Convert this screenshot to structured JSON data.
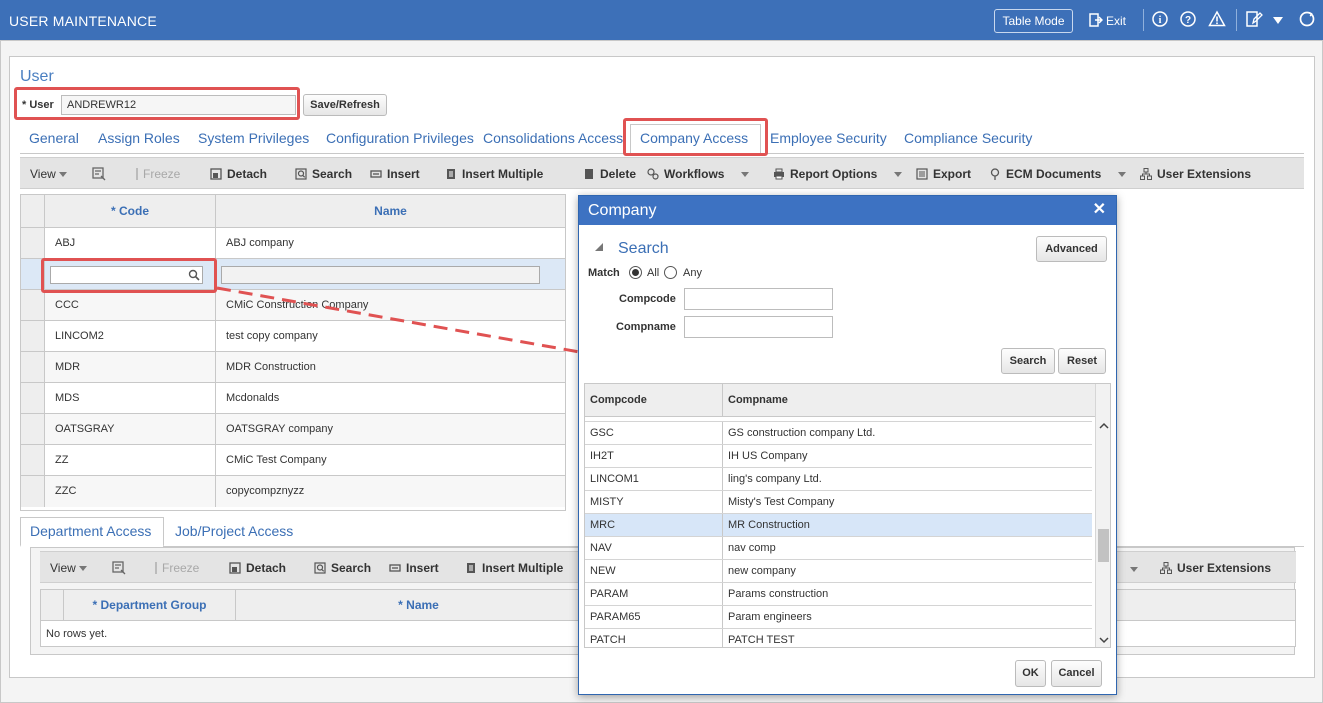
{
  "header": {
    "title": "USER MAINTENANCE",
    "table_mode": "Table Mode",
    "exit": "Exit"
  },
  "user": {
    "heading": "User",
    "label": "* User",
    "value": "ANDREWR12",
    "save_refresh": "Save/Refresh"
  },
  "tabs": [
    "General",
    "Assign Roles",
    "System Privileges",
    "Configuration Privileges",
    "Consolidations Access",
    "Company Access",
    "Employee Security",
    "Compliance Security"
  ],
  "toolbar": {
    "view": "View",
    "freeze": "Freeze",
    "detach": "Detach",
    "search": "Search",
    "insert": "Insert",
    "insert_multiple": "Insert Multiple",
    "delete": "Delete",
    "workflows": "Workflows",
    "report_options": "Report Options",
    "export": "Export",
    "ecm_documents": "ECM Documents",
    "user_extensions": "User Extensions"
  },
  "company_grid": {
    "col_code": "* Code",
    "col_name": "Name",
    "rows": [
      {
        "code": "ABJ",
        "name": "ABJ company"
      },
      {
        "code": "",
        "name": ""
      },
      {
        "code": "CCC",
        "name": "CMiC Construction Company"
      },
      {
        "code": "LINCOM2",
        "name": "test copy company"
      },
      {
        "code": "MDR",
        "name": "MDR Construction"
      },
      {
        "code": "MDS",
        "name": "Mcdonalds"
      },
      {
        "code": "OATSGRAY",
        "name": "OATSGRAY company"
      },
      {
        "code": "ZZ",
        "name": "CMiC Test Company"
      },
      {
        "code": "ZZC",
        "name": "copycompznyzz"
      }
    ]
  },
  "sub_tabs": [
    "Department Access",
    "Job/Project Access"
  ],
  "dept_toolbar": {
    "view": "View",
    "freeze": "Freeze",
    "detach": "Detach",
    "search": "Search",
    "insert": "Insert",
    "insert_multiple": "Insert Multiple",
    "user_extensions": "User Extensions"
  },
  "dept_grid": {
    "col_group": "* Department Group",
    "col_name": "* Name",
    "empty": "No rows yet."
  },
  "modal": {
    "title": "Company",
    "search_title": "Search",
    "advanced": "Advanced",
    "match": "Match",
    "all": "All",
    "any": "Any",
    "compcode_label": "Compcode",
    "compname_label": "Compname",
    "search_btn": "Search",
    "reset_btn": "Reset",
    "col_compcode": "Compcode",
    "col_compname": "Compname",
    "rows": [
      {
        "code": "GSC",
        "name": "GS construction company Ltd."
      },
      {
        "code": "IH2T",
        "name": "IH US Company"
      },
      {
        "code": "LINCOM1",
        "name": "ling's company Ltd."
      },
      {
        "code": "MISTY",
        "name": "Misty's Test Company"
      },
      {
        "code": "MRC",
        "name": "MR Construction"
      },
      {
        "code": "NAV",
        "name": "nav comp"
      },
      {
        "code": "NEW",
        "name": "new company"
      },
      {
        "code": "PARAM",
        "name": "Params construction"
      },
      {
        "code": "PARAM65",
        "name": "Param engineers"
      },
      {
        "code": "PATCH",
        "name": "PATCH TEST"
      }
    ],
    "ok": "OK",
    "cancel": "Cancel"
  },
  "colors": {
    "header_bg": "#3d70b8",
    "link_blue": "#3b6fb5",
    "highlight_red": "#e05252",
    "selected_row": "#d7e6f8"
  }
}
